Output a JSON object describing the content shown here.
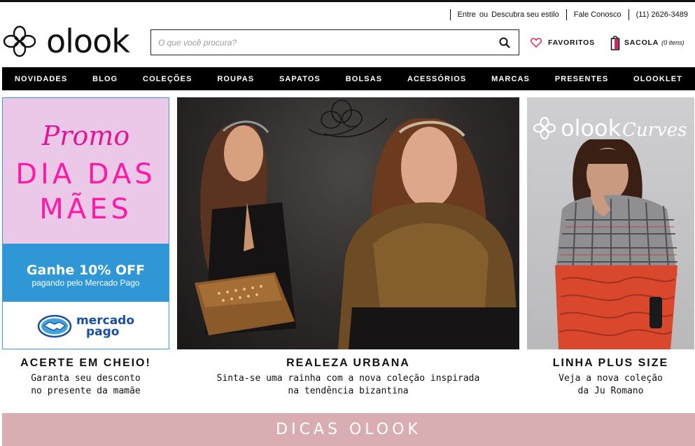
{
  "utility": {
    "login": "Entre",
    "or": "ou",
    "discover": "Descubra seu estilo",
    "contact": "Fale Conosco",
    "phone": "(11) 2626-3489"
  },
  "brand": {
    "logo_text": "olook"
  },
  "search": {
    "placeholder": "O que você procura?"
  },
  "header": {
    "favorites_label": "FAVORITOS",
    "bag_label": "SACOLA",
    "bag_items": "(0 itens)"
  },
  "nav": {
    "items": [
      "NOVIDADES",
      "BLOG",
      "COLEÇÕES",
      "ROUPAS",
      "SAPATOS",
      "BOLSAS",
      "ACESSÓRIOS",
      "MARCAS",
      "PRESENTES",
      "OLOOKLET"
    ]
  },
  "promo": {
    "word": "Promo",
    "line1": "DIA DAS",
    "line2": "MÃES",
    "offer": "Ganhe 10% OFF",
    "offer_sub": "pagando pelo Mercado Pago",
    "mp_line1": "mercado",
    "mp_line2": "pago"
  },
  "curves": {
    "logo_main": "olook",
    "logo_sub": "Curves"
  },
  "cards": [
    {
      "title": "ACERTE EM CHEIO!",
      "line1": "Garanta seu desconto",
      "line2": "no presente da mamãe"
    },
    {
      "title": "REALEZA URBANA",
      "line1": "Sinta-se uma rainha com a nova coleção inspirada",
      "line2": "na tendência bizantina"
    },
    {
      "title": "LINHA PLUS SIZE",
      "line1": "Veja a nova coleção",
      "line2": "da Ju Romano"
    }
  ],
  "dicas": {
    "label": "DICAS OLOOK"
  },
  "colors": {
    "nav_bg": "#000000",
    "promo_pink": "#ecc8e8",
    "promo_magenta": "#ff1aa5",
    "mercado_blue": "#2f97d6",
    "dicas_bg": "#d9aeb3"
  },
  "icons": [
    "olook-logo-icon",
    "search-icon",
    "heart-icon",
    "shopping-bag-icon",
    "handshake-icon"
  ]
}
